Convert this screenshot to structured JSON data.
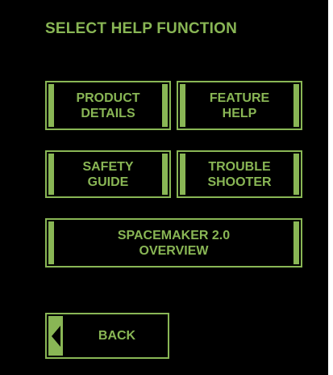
{
  "screen": {
    "title": "SELECT HELP FUNCTION"
  },
  "menu": {
    "product_details": {
      "line1": "PRODUCT",
      "line2": "DETAILS"
    },
    "feature_help": {
      "line1": "FEATURE",
      "line2": "HELP"
    },
    "safety_guide": {
      "line1": "SAFETY",
      "line2": "GUIDE"
    },
    "trouble_shooter": {
      "line1": "TROUBLE",
      "line2": "SHOOTER"
    },
    "overview": {
      "line1": "SPACEMAKER 2.0",
      "line2": "OVERVIEW"
    }
  },
  "navigation": {
    "back_label": "BACK",
    "back_icon": "left-arrow-icon"
  },
  "colors": {
    "background": "#000000",
    "accent": "#89b655"
  }
}
